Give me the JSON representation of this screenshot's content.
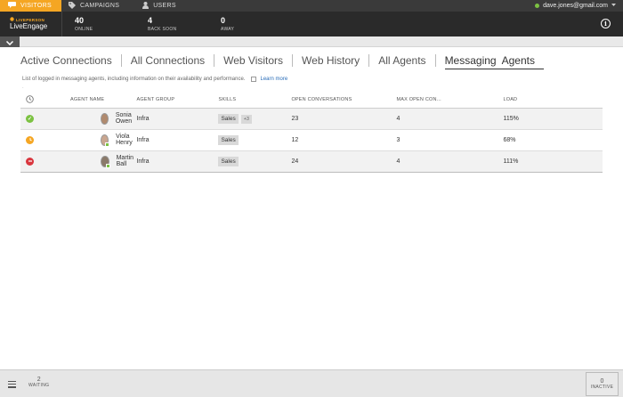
{
  "topnav": {
    "tabs": [
      {
        "label": "VISITORS",
        "icon": "chat-bubble-icon"
      },
      {
        "label": "CAMPAIGNS",
        "icon": "tag-icon"
      },
      {
        "label": "USERS",
        "icon": "user-icon"
      }
    ],
    "user_email": "dave.jones@gmail.com"
  },
  "header": {
    "brand_top": "LIVEPERSON",
    "brand_main": "LiveEngage",
    "stats": [
      {
        "value": "40",
        "label": "ONLINE"
      },
      {
        "value": "4",
        "label": "BACK SOON"
      },
      {
        "value": "0",
        "label": "AWAY"
      }
    ]
  },
  "tabs": [
    "Active Connections",
    "All Connections",
    "Web Visitors",
    "Web History",
    "All Agents",
    "Messaging  Agents"
  ],
  "active_tab": "Messaging  Agents",
  "description": "List of logged in messaging agents, including information on their availability and performance.",
  "learn_more": "Learn more",
  "desc_dot": "·",
  "table": {
    "headers": [
      "",
      "AGENT NAME",
      "AGENT GROUP",
      "SKILLS",
      "OPEN CONVERSATIONS",
      "MAX OPEN CON...",
      "LOAD"
    ],
    "rows": [
      {
        "status": "online",
        "status_color": "#7cc242",
        "name": "Sonia Owen",
        "group": "Infra",
        "skill": "Sales",
        "more": "+3",
        "open": "23",
        "max": "4",
        "load": "115%"
      },
      {
        "status": "back-soon",
        "status_color": "#f5a623",
        "name": "Viola Henry",
        "group": "Infra",
        "skill": "Sales",
        "more": "",
        "open": "12",
        "max": "3",
        "load": "68%"
      },
      {
        "status": "away",
        "status_color": "#d9363e",
        "name": "Martin Ball",
        "group": "Infra",
        "skill": "Sales",
        "more": "",
        "open": "24",
        "max": "4",
        "load": "111%"
      }
    ]
  },
  "footer": {
    "waiting_count": "2",
    "waiting_label": "WAITING",
    "inactive_count": "0",
    "inactive_label": "INACTIVE"
  },
  "colors": {
    "accent": "#f5a623",
    "online": "#7cc242",
    "away": "#d9363e",
    "link": "#2a6db8"
  }
}
